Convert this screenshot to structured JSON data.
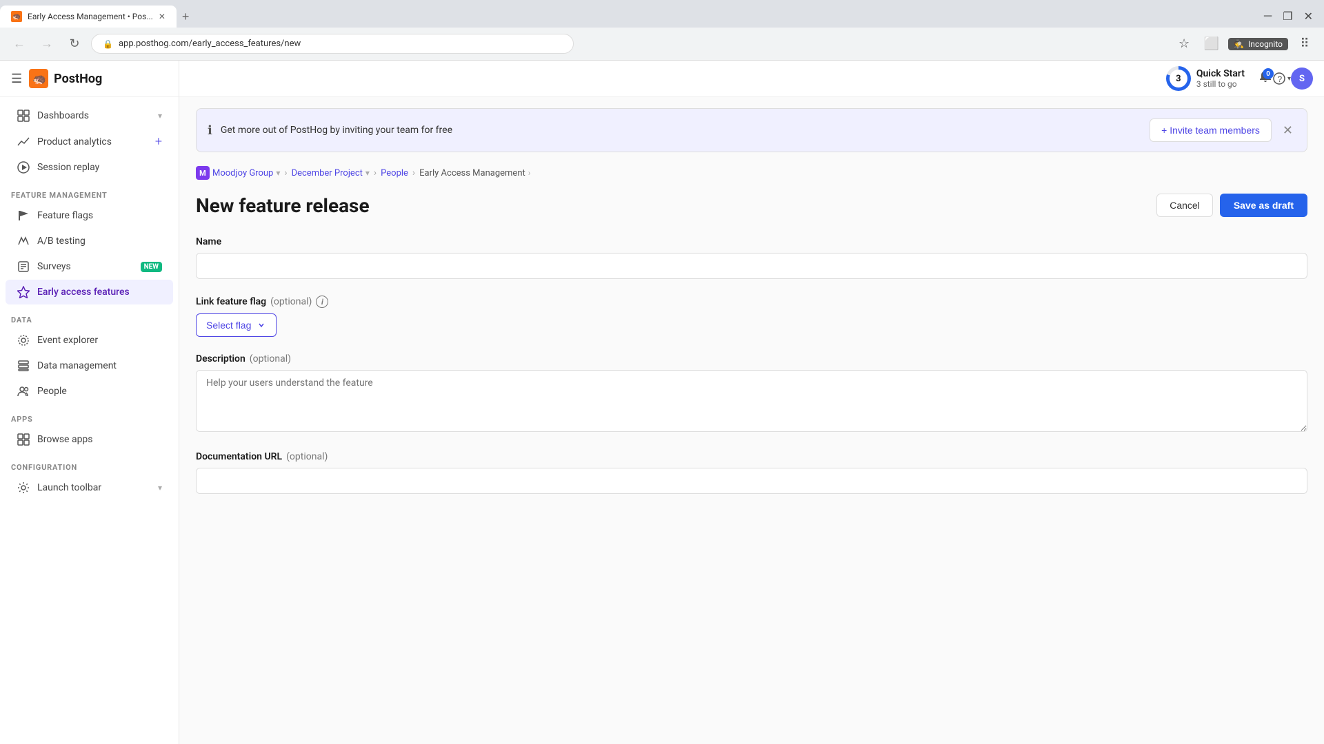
{
  "browser": {
    "tab_title": "Early Access Management • Pos...",
    "address": "app.posthog.com/early_access_features/new",
    "incognito_label": "Incognito"
  },
  "topbar": {
    "quick_start_label": "Quick Start",
    "quick_start_subtitle": "3 still to go",
    "quick_start_count": "3",
    "notification_count": "0",
    "user_initial": "S"
  },
  "sidebar": {
    "logo_text": "PostHog",
    "items": [
      {
        "id": "dashboards",
        "label": "Dashboards",
        "icon": "📊",
        "has_arrow": true
      },
      {
        "id": "product-analytics",
        "label": "Product analytics",
        "icon": "📈",
        "has_plus": true
      },
      {
        "id": "session-replay",
        "label": "Session replay",
        "icon": "▶️"
      },
      {
        "id": "feature-flags",
        "label": "Feature flags",
        "icon": "🏴"
      },
      {
        "id": "ab-testing",
        "label": "A/B testing",
        "icon": "🔬"
      },
      {
        "id": "surveys",
        "label": "Surveys",
        "icon": "📋",
        "badge": "NEW"
      },
      {
        "id": "early-access-features",
        "label": "Early access features",
        "icon": "✨",
        "active": true
      }
    ],
    "sections": {
      "feature_management": "FEATURE MANAGEMENT",
      "data": "DATA",
      "apps": "APPS",
      "configuration": "CONFIGURATION"
    },
    "data_items": [
      {
        "id": "event-explorer",
        "label": "Event explorer",
        "icon": "🔍"
      },
      {
        "id": "data-management",
        "label": "Data management",
        "icon": "🗃️"
      },
      {
        "id": "people",
        "label": "People",
        "icon": "👥"
      }
    ],
    "apps_items": [
      {
        "id": "browse-apps",
        "label": "Browse apps",
        "icon": "⚡"
      }
    ],
    "config_items": [
      {
        "id": "launch-toolbar",
        "label": "Launch toolbar",
        "icon": "🔧",
        "has_arrow": true
      }
    ]
  },
  "banner": {
    "text": "Get more out of PostHog by inviting your team for free",
    "action_label": "+ Invite team members"
  },
  "breadcrumb": {
    "org": "M",
    "org_label": "Moodjoy Group",
    "project_label": "December Project",
    "people_label": "People",
    "current_label": "Early Access Management"
  },
  "page": {
    "title": "New feature release",
    "cancel_label": "Cancel",
    "save_label": "Save as draft",
    "name_label": "Name",
    "link_flag_label": "Link feature flag",
    "link_flag_optional": "(optional)",
    "select_flag_label": "Select flag",
    "description_label": "Description",
    "description_optional": "(optional)",
    "description_placeholder": "Help your users understand the feature",
    "doc_url_label": "Documentation URL",
    "doc_url_optional": "(optional)"
  }
}
